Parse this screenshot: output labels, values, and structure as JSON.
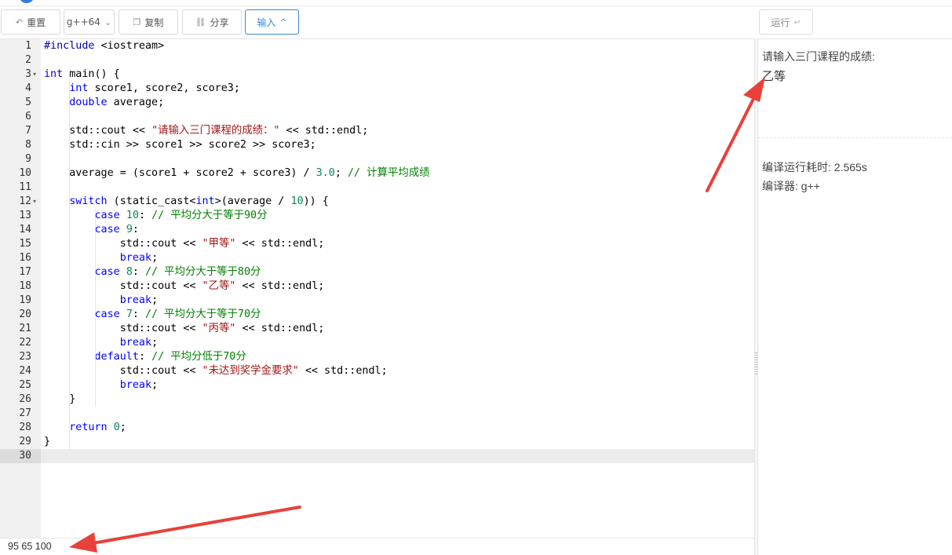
{
  "toolbar": {
    "reset_label": "重置",
    "compiler_label": "g++64",
    "copy_label": "复制",
    "share_label": "分享",
    "input_label": "输入",
    "run_label": "运行"
  },
  "icons": {
    "reset": "undo-icon",
    "copy": "copy-icon",
    "share": "link-icon",
    "compiler_dropdown": "chevron-down-icon",
    "input_toggle": "chevron-up-icon",
    "run": "return-icon"
  },
  "editor": {
    "line_numbers": [
      "1",
      "2",
      "3",
      "4",
      "5",
      "6",
      "7",
      "8",
      "9",
      "10",
      "11",
      "12",
      "13",
      "14",
      "15",
      "16",
      "17",
      "18",
      "19",
      "20",
      "21",
      "22",
      "23",
      "24",
      "25",
      "26",
      "27",
      "28",
      "29",
      "30"
    ],
    "lines": [
      "#include <iostream>",
      "",
      "int main() {",
      "    int score1, score2, score3;",
      "    double average;",
      "",
      "    std::cout << \"请输入三门课程的成绩：\" << std::endl;",
      "    std::cin >> score1 >> score2 >> score3;",
      "",
      "    average = (score1 + score2 + score3) / 3.0; // 计算平均成绩",
      "",
      "    switch (static_cast<int>(average / 10)) {",
      "        case 10: // 平均分大于等于90分",
      "        case 9:",
      "            std::cout << \"甲等\" << std::endl;",
      "            break;",
      "        case 8: // 平均分大于等于80分",
      "            std::cout << \"乙等\" << std::endl;",
      "            break;",
      "        case 7: // 平均分大于等于70分",
      "            std::cout << \"丙等\" << std::endl;",
      "            break;",
      "        default: // 平均分低于70分",
      "            std::cout << \"未达到奖学金要求\" << std::endl;",
      "            break;",
      "    }",
      "",
      "    return 0;",
      "}",
      ""
    ]
  },
  "stdin": {
    "value": "95 65 100"
  },
  "output": {
    "prompt_line": "请输入三门课程的成绩:",
    "result_line": "乙等",
    "time_line": "编译运行耗时: 2.565s",
    "compiler_line": "编译器: g++"
  },
  "colors": {
    "accent": "#3a87d6",
    "keyword": "#0000ff",
    "string": "#a31515",
    "comment": "#008000",
    "number": "#098658",
    "arrow": "#e8413a"
  }
}
